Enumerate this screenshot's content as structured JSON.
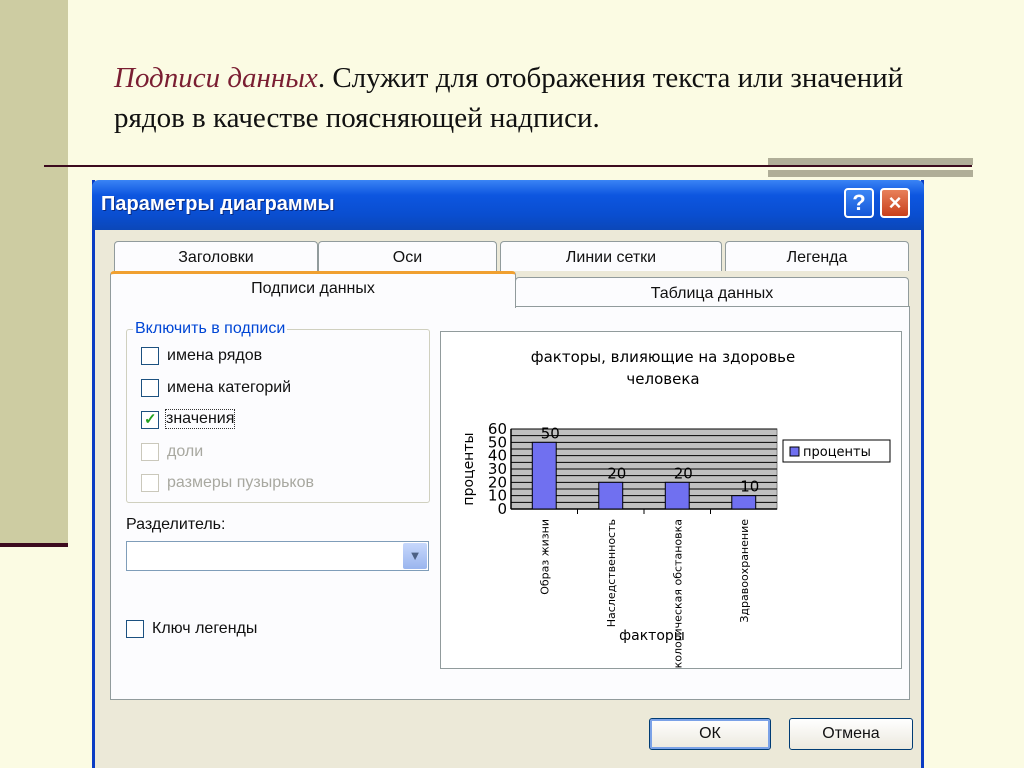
{
  "slide": {
    "heading_italic": "Подписи данных",
    "heading_rest": ". Служит для отображения текста или значений рядов в качестве поясняющей надписи."
  },
  "dialog": {
    "title": "Параметры диаграммы",
    "help_label": "?",
    "close_label": "×",
    "tabs": [
      "Заголовки",
      "Оси",
      "Линии сетки",
      "Легенда",
      "Подписи данных",
      "Таблица данных"
    ],
    "active_tab": "Подписи данных",
    "group_title": "Включить в подписи",
    "checkboxes": [
      {
        "label": "имена рядов",
        "checked": false,
        "enabled": true
      },
      {
        "label": "имена категорий",
        "checked": false,
        "enabled": true
      },
      {
        "label": "значения",
        "checked": true,
        "enabled": true
      },
      {
        "label": "доли",
        "checked": false,
        "enabled": false
      },
      {
        "label": "размеры пузырьков",
        "checked": false,
        "enabled": false
      }
    ],
    "separator_label": "Разделитель:",
    "separator_value": "",
    "legend_key_label": "Ключ легенды",
    "legend_key_checked": false,
    "ok_label": "ОК",
    "cancel_label": "Отмена",
    "colors": {
      "titlebar": "#0a4ed0",
      "accent_tab": "#f0a030",
      "bar_fill": "#7070f0",
      "plot_bg": "#c0c0c0"
    }
  },
  "chart_data": {
    "type": "bar",
    "title": "факторы, влияющие на здоровье человека",
    "xlabel": "факторы",
    "ylabel": "проценты",
    "categories": [
      "Образ жизни",
      "Наследственность",
      "Экологическая обстановка",
      "Здравоохранение"
    ],
    "series": [
      {
        "name": "проценты",
        "values": [
          50,
          20,
          20,
          10
        ]
      }
    ],
    "data_labels": [
      "50",
      "20",
      "20",
      "10"
    ],
    "yticks": [
      "0",
      "10",
      "20",
      "30",
      "40",
      "50",
      "60"
    ],
    "ylim": [
      0,
      60
    ],
    "grid": true,
    "legend_position": "right"
  }
}
